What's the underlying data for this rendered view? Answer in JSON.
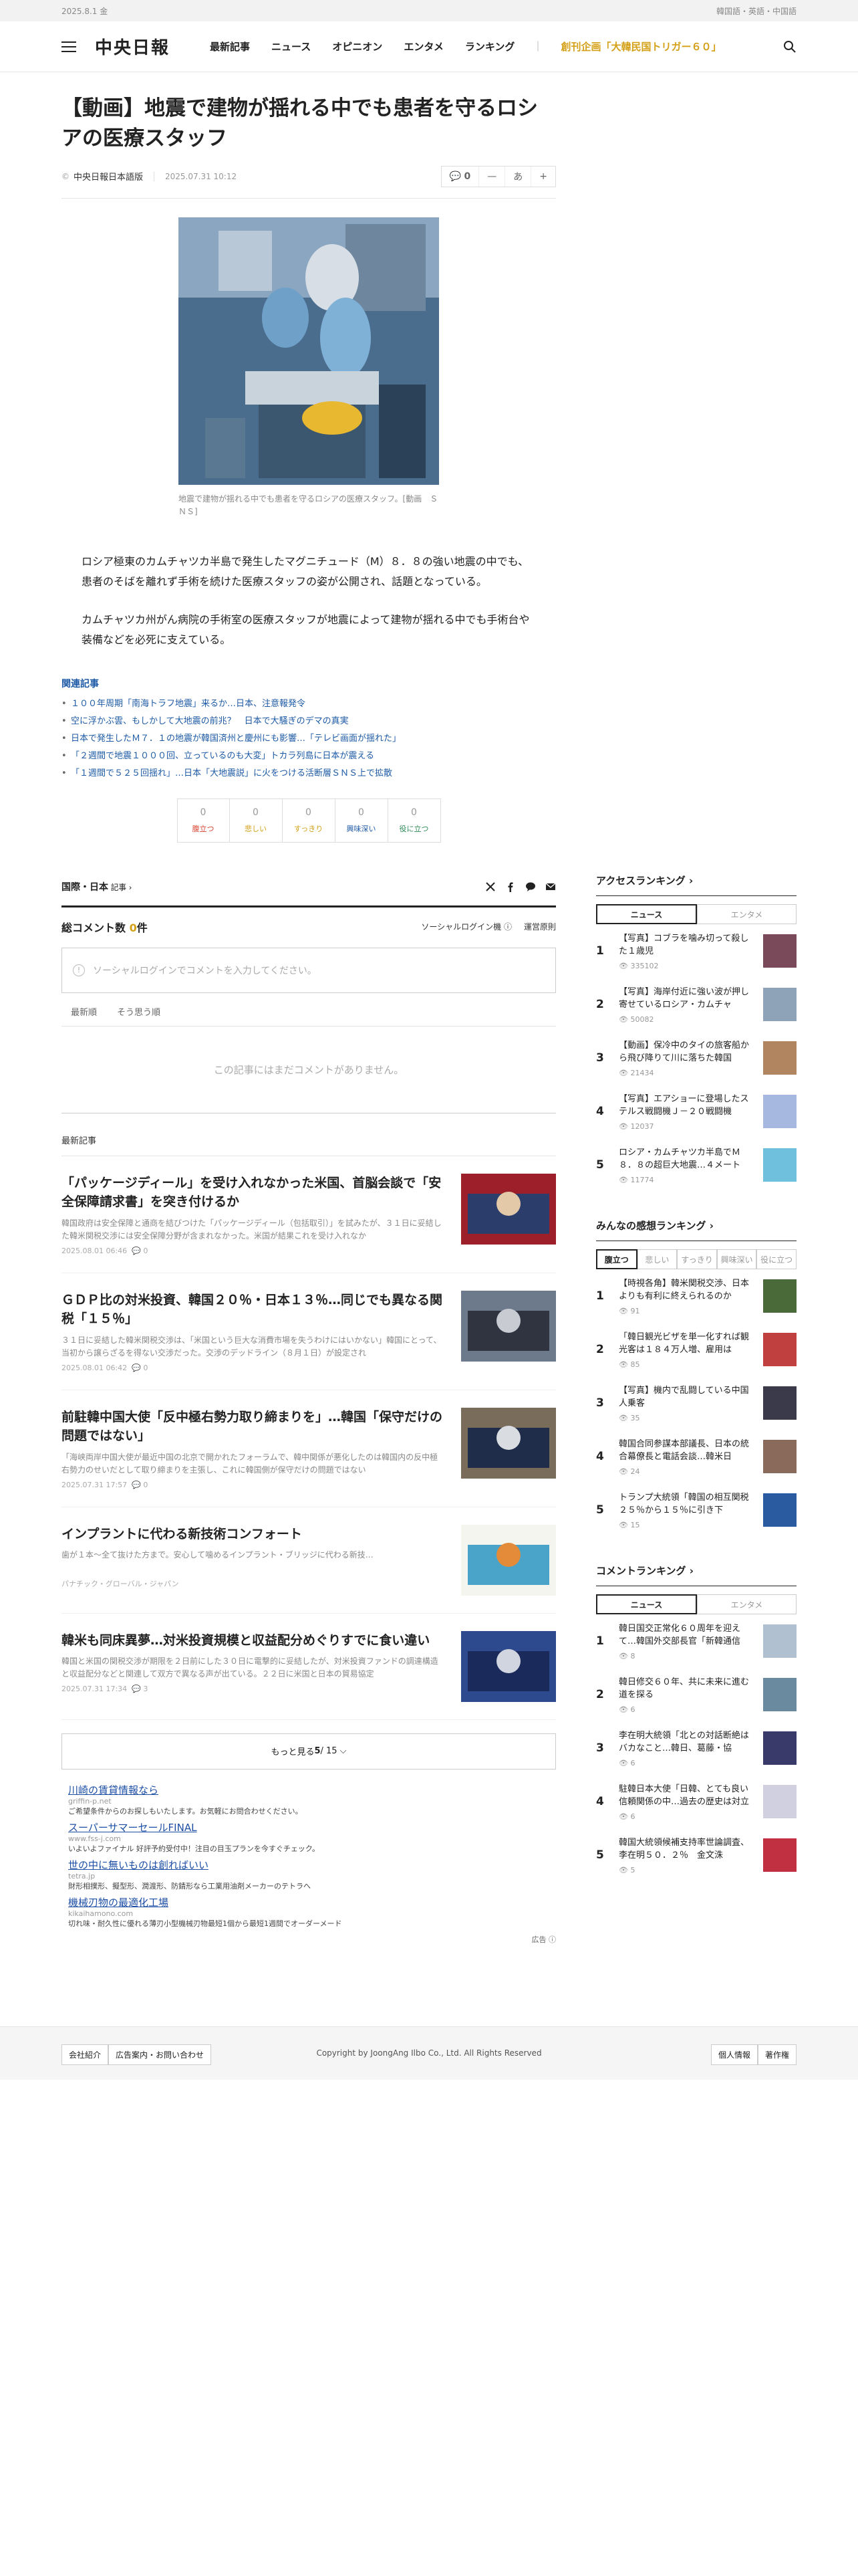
{
  "topbar": {
    "date": "2025.8.1 金",
    "languages": "韓国語・英語・中国語"
  },
  "header": {
    "logo": "中央日報",
    "nav": [
      {
        "label": "最新記事"
      },
      {
        "label": "ニュース"
      },
      {
        "label": "オピニオン"
      },
      {
        "label": "エンタメ"
      },
      {
        "label": "ランキング"
      }
    ],
    "special": "創刊企画「大韓民国トリガー６０」",
    "icons": {
      "menu": "hamburger-icon",
      "search": "search-icon"
    }
  },
  "article": {
    "headline": "【動画】地震で建物が揺れる中でも患者を守るロシアの医療スタッフ",
    "author": "中央日報日本語版",
    "date": "2025.07.31 10:12",
    "tools": {
      "comments": "0",
      "font_minus": "—",
      "font_label": "あ",
      "font_plus": "+"
    },
    "caption": "地震で建物が揺れる中でも患者を守るロシアの医療スタッフ。[動画　ＳＮＳ]",
    "paragraphs": [
      "ロシア極東のカムチャツカ半島で発生したマグニチュード（M）８．８の強い地震の中でも、患者のそばを離れず手術を続けた医療スタッフの姿が公開され、話題となっている。",
      "カムチャツカ州がん病院の手術室の医療スタッフが地震によって建物が揺れる中でも手術台や装備などを必死に支えている。"
    ],
    "related_title": "関連記事",
    "related": [
      "１００年周期「南海トラフ地震」来るか…日本、注意報発令",
      "空に浮かぶ雲、もしかして大地震の前兆？　日本で大騒ぎのデマの真実",
      "日本で発生したＭ７．１の地震が韓国済州と慶州にも影響…「テレビ画面が揺れた」",
      "「２週間で地震１０００回、立っているのも大変」トカラ列島に日本が震える",
      "「１週間で５２５回揺れ」…日本「大地震説」に火をつける活断層ＳＮＳ上で拡散"
    ],
    "reactions": [
      {
        "count": "0",
        "label": "腹立つ",
        "color": "#d9432f"
      },
      {
        "count": "0",
        "label": "悲しい",
        "color": "#d4a017"
      },
      {
        "count": "0",
        "label": "すっきり",
        "color": "#d4a017"
      },
      {
        "count": "0",
        "label": "興味深い",
        "color": "#1d5aa5"
      },
      {
        "count": "0",
        "label": "役に立つ",
        "color": "#2e8b57"
      }
    ],
    "category": "国際・日本",
    "category_suffix": " 記事 ›"
  },
  "comments": {
    "title_prefix": "総コメント数 ",
    "count": "0",
    "title_suffix": "件",
    "social_login": "ソーシャルログイン機 ⓘ",
    "rules": "運営原則",
    "placeholder": "ソーシャルログインでコメントを入力してください。",
    "sort_tabs": [
      "最新順",
      "そう思う順"
    ],
    "empty": "この記事にはまだコメントがありません。"
  },
  "latest": {
    "label": "最新記事",
    "items": [
      {
        "title": "「パッケージディール」を受け入れなかった米国、首脳会談で「安全保障請求書」を突き付けるか",
        "summary": "韓国政府は安全保障と通商を結びつけた「パッケージディール（包括取引）」を試みたが、３１日に妥結した韓米関税交渉には安全保障分野が含まれなかった。米国が結果これを受け入れなか",
        "meta": "2025.08.01 06:46",
        "comments": "0"
      },
      {
        "title": "ＧＤＰ比の対米投資、韓国２０％・日本１３％…同じでも異なる関税「１５％」",
        "summary": "３１日に妥結した韓米関税交渉は、「米国という巨大な消費市場を失うわけにはいかない」韓国にとって、当初から譲らざるを得ない交渉だった。交渉のデッドライン（８月１日）が設定され",
        "meta": "2025.08.01 06:42",
        "comments": "0"
      },
      {
        "title": "前駐韓中国大使「反中極右勢力取り締まりを」…韓国「保守だけの問題ではない」",
        "summary": "「海峡両岸中国大使が最近中国の北京で開かれたフォーラムで、韓中関係が悪化したのは韓国内の反中極右勢力のせいだとして取り締まりを主張し、これに韓国側が保守だけの問題ではない",
        "meta": "2025.07.31 17:57",
        "comments": "0"
      },
      {
        "title": "インプラントに代わる新技術コンフォート",
        "summary": "歯が１本～全て抜けた方まで。安心して噛めるインプラント・ブリッジに代わる新技…",
        "meta": "パナチック・グローバル・ジャパン",
        "comments": ""
      },
      {
        "title": "韓米も同床異夢…対米投資規模と収益配分めぐりすでに食い違い",
        "summary": "韓国と米国の関税交渉が期限を２日前にした３０日に電撃的に妥結したが、対米投資ファンドの調達構造と収益配分などと関連して双方で異なる声が出ている。２２日に米国と日本の貿易協定",
        "meta": "2025.07.31 17:34",
        "comments": "3"
      }
    ],
    "more_label": "もっと見る ",
    "more_page": "5",
    "more_total": " / 15 ⌵"
  },
  "ads": {
    "items": [
      {
        "title": "川崎の賃貸情報なら",
        "url": "griffin-p.net",
        "desc": "ご希望条件からのお探しもいたします。お気軽にお問合わせください。"
      },
      {
        "title": "スーパーサマーセールFINAL",
        "url": "www.fss-j.com",
        "desc": "いよいよファイナル 好評予約受付中！注目の目玉プランを今すぐチェック。"
      },
      {
        "title": "世の中に無いものは創ればいい",
        "url": "tetra.jp",
        "desc": "財形相撲形、擬型形、潤渡形、防錆形なら工業用油剤メーカーのテトラへ"
      },
      {
        "title": "機械刃物の最適化工場",
        "url": "kikaihamono.com",
        "desc": "切れ味・耐久性に優れる薄刃小型機械刃物最短1個から最短1週間でオーダーメード"
      }
    ],
    "mark": "広告 ⓘ"
  },
  "sidebar": {
    "access": {
      "title": "アクセスランキング ›",
      "tabs": [
        "ニュース",
        "エンタメ"
      ],
      "items": [
        {
          "rank": "1",
          "title": "【写真】コブラを噛み切って殺した１歳児",
          "views": "335102"
        },
        {
          "rank": "2",
          "title": "【写真】海岸付近に強い波が押し寄せているロシア・カムチャ",
          "views": "50082"
        },
        {
          "rank": "3",
          "title": "【動画】保冷中のタイの旅客船から飛び降りて川に落ちた韓国",
          "views": "21434"
        },
        {
          "rank": "4",
          "title": "【写真】エアショーに登場したステルス戦闘機Ｊ－２０戦闘機",
          "views": "12037"
        },
        {
          "rank": "5",
          "title": "ロシア・カムチャツカ半島でＭ８．８の超巨大地震…４メート",
          "views": "11774"
        }
      ]
    },
    "reaction": {
      "title": "みんなの感想ランキング ›",
      "tabs": [
        "腹立つ",
        "悲しい",
        "すっきり",
        "興味深い",
        "役に立つ"
      ],
      "items": [
        {
          "rank": "1",
          "title": "【時視各角】韓米関税交渉、日本よりも有利に終えられるのか",
          "views": "91"
        },
        {
          "rank": "2",
          "title": "「韓日観光ビザを単一化すれば観光客は１８４万人増、雇用は",
          "views": "85"
        },
        {
          "rank": "3",
          "title": "【写真】機内で乱闘している中国人乗客",
          "views": "35"
        },
        {
          "rank": "4",
          "title": "韓国合同参謀本部議長、日本の統合幕僚長と電話会談…韓米日",
          "views": "24"
        },
        {
          "rank": "5",
          "title": "トランプ大統領「韓国の相互関税２５％から１５％に引き下",
          "views": "15"
        }
      ]
    },
    "comment": {
      "title": "コメントランキング ›",
      "tabs": [
        "ニュース",
        "エンタメ"
      ],
      "items": [
        {
          "rank": "1",
          "title": "韓日国交正常化６０周年を迎えて…韓国外交部長官「新韓通信",
          "views": "8"
        },
        {
          "rank": "2",
          "title": "韓日修交６０年、共に未来に進む道を探る",
          "views": "6"
        },
        {
          "rank": "3",
          "title": "李在明大統領「北との対話断絶はバカなこと…韓日、葛藤・協",
          "views": "6"
        },
        {
          "rank": "4",
          "title": "駐韓日本大使「日韓、とても良い信頼関係の中…過去の歴史は対立",
          "views": "6"
        },
        {
          "rank": "5",
          "title": "韓国大統領候補支持率世論調査、李在明５０．２％　金文洙",
          "views": "5"
        }
      ]
    }
  },
  "footer": {
    "links": [
      "会社紹介",
      "広告案内・お問い合わせ"
    ],
    "copyright": "Copyright by JoongAng Ilbo Co., Ltd. All Rights Reserved",
    "right": [
      "個人情報",
      "著作権"
    ]
  }
}
